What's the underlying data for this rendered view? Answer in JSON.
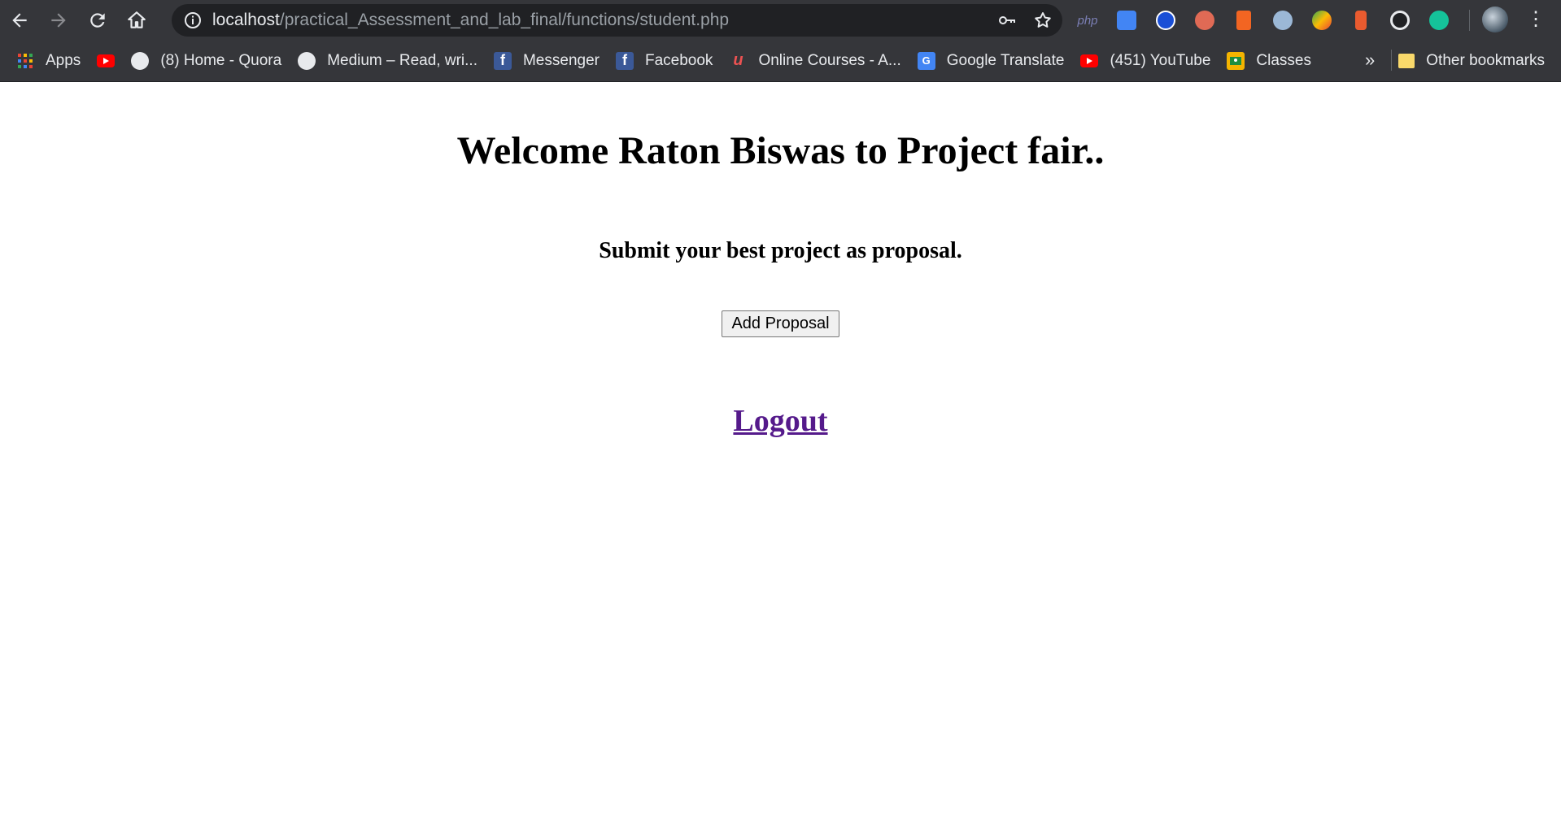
{
  "browser": {
    "url_host": "localhost",
    "url_path": "/practical_Assessment_and_lab_final/functions/student.php",
    "extension_php_label": "php"
  },
  "bookmarks": {
    "items": [
      {
        "label": "Apps",
        "icon": "apps-grid-icon",
        "color": "#ea4335"
      },
      {
        "label": "",
        "icon": "youtube-icon",
        "color": "#ff0000"
      },
      {
        "label": "(8) Home - Quora",
        "icon": "globe-icon",
        "color": "#e8eaed"
      },
      {
        "label": "Medium – Read, wri...",
        "icon": "globe-icon",
        "color": "#e8eaed"
      },
      {
        "label": "Messenger",
        "icon": "facebook-icon",
        "color": "#3b5998"
      },
      {
        "label": "Facebook",
        "icon": "facebook-icon",
        "color": "#3b5998"
      },
      {
        "label": "Online Courses - A...",
        "icon": "udemy-icon",
        "color": "#ec5252"
      },
      {
        "label": "Google Translate",
        "icon": "translate-icon",
        "color": "#4285f4"
      },
      {
        "label": "(451) YouTube",
        "icon": "youtube-icon",
        "color": "#ff0000"
      },
      {
        "label": "Classes",
        "icon": "classroom-icon",
        "color": "#f4b400"
      }
    ],
    "overflow_label": "»",
    "other_label": "Other bookmarks"
  },
  "page": {
    "heading": "Welcome Raton Biswas to Project fair..",
    "subheading": "Submit your best project as proposal.",
    "add_button_label": "Add Proposal",
    "logout_label": "Logout"
  },
  "colors": {
    "toolbar_bg": "#35363a",
    "omnibox_bg": "#202124",
    "link_visited": "#551a8b"
  }
}
